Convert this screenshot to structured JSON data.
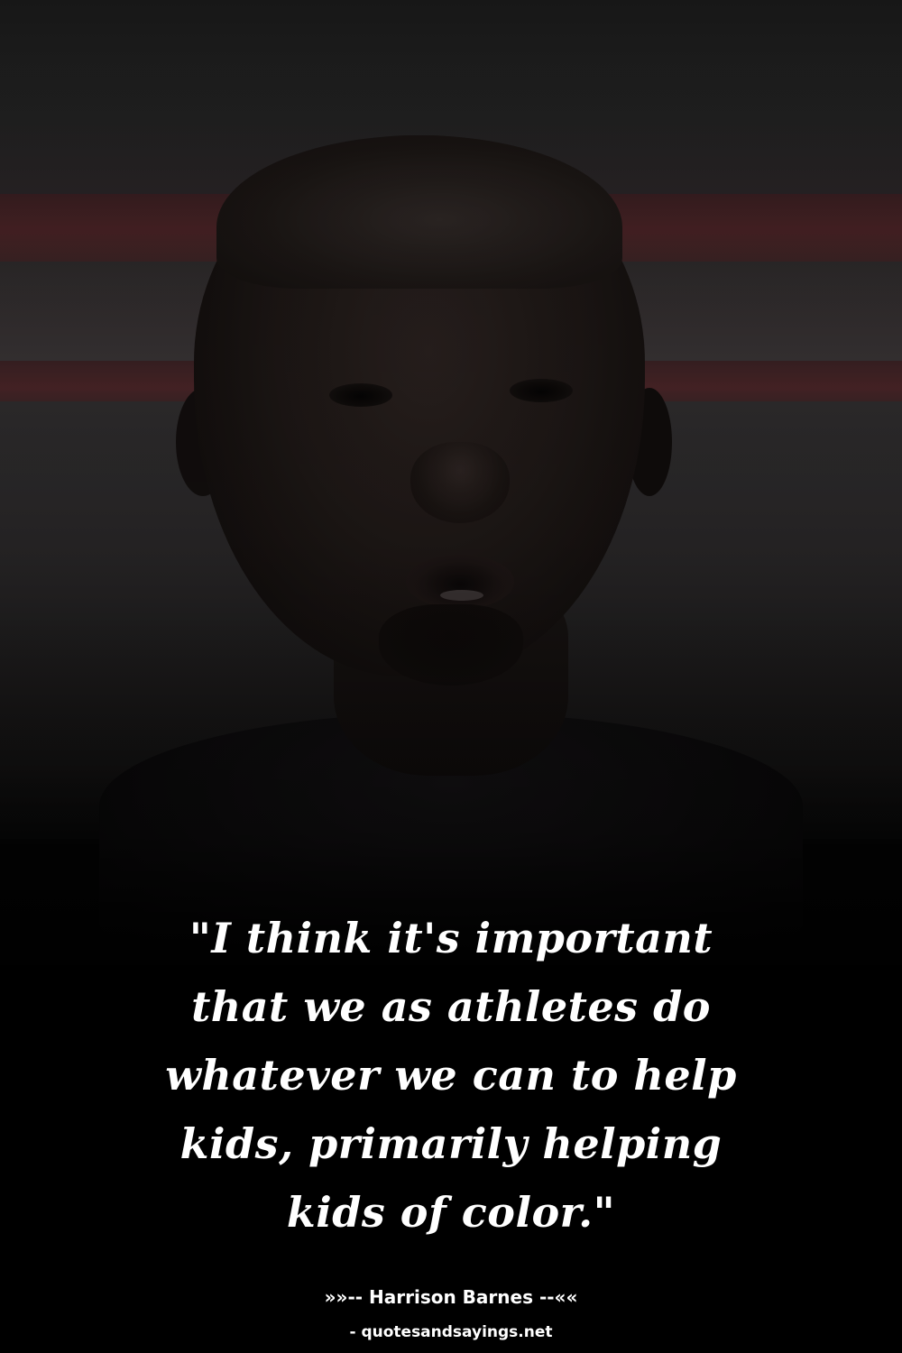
{
  "quote": {
    "lines": [
      "\"I think it's important",
      "that we as athletes do",
      "whatever we can to help",
      "kids, primarily helping",
      "kids of color.\""
    ]
  },
  "author": {
    "text": "»»-- Harrison Barnes --««"
  },
  "source": {
    "text": "- quotesandsayings.net"
  }
}
